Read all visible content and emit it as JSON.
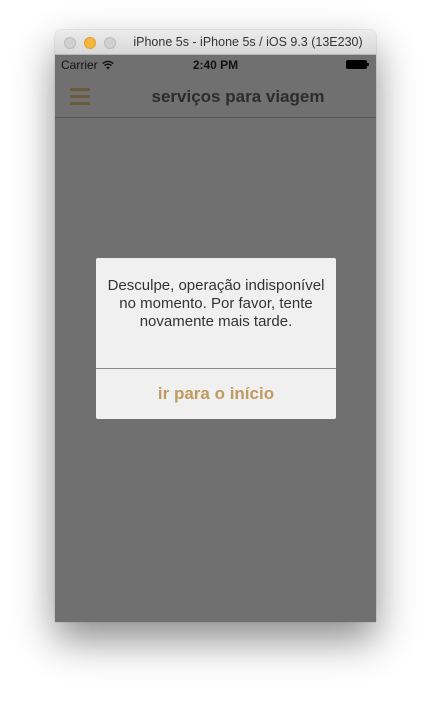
{
  "window": {
    "title": "iPhone 5s - iPhone 5s / iOS 9.3 (13E230)"
  },
  "statusbar": {
    "carrier": "Carrier",
    "time": "2:40 PM"
  },
  "navbar": {
    "title": "serviços para viagem",
    "menu_icon": "hamburger-menu-icon"
  },
  "dialog": {
    "message": "Desculpe, operação indisponível no momento. Por favor, tente novamente mais tarde.",
    "button_label": "ir para o início"
  },
  "colors": {
    "screen_background": "#707070",
    "dialog_background": "#f0f0f0",
    "accent": "#c09a5e",
    "menu_icon": "#6a5a3a"
  }
}
